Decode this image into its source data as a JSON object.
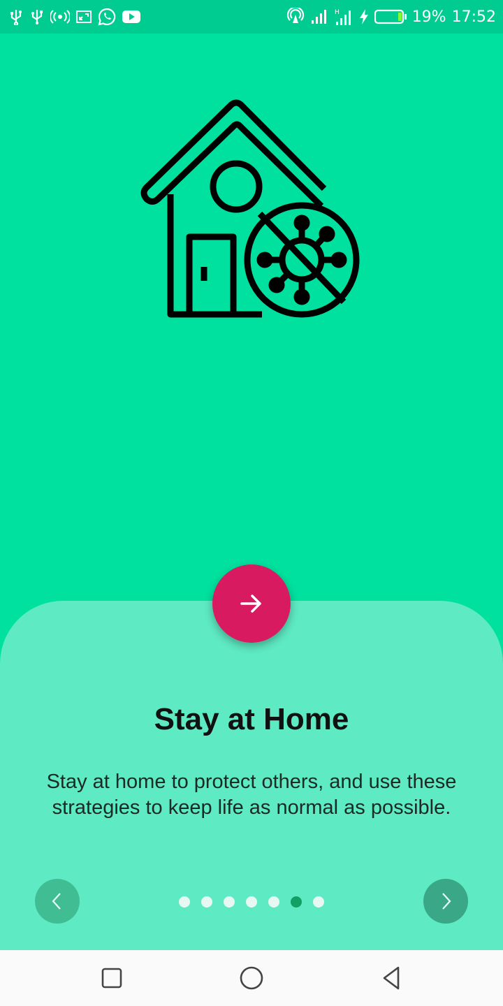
{
  "status_bar": {
    "left_icons": [
      "usb-icon",
      "usb-debug-icon",
      "hotspot-icon",
      "screen-cast-icon",
      "whatsapp-icon",
      "youtube-icon"
    ],
    "right_icons": [
      "wifi-icon",
      "signal-icon",
      "signal-h-icon",
      "charging-icon",
      "battery-icon"
    ],
    "battery": "19%",
    "time": "17:52"
  },
  "hero": {
    "icon": "stay-home-virus-icon"
  },
  "onboarding": {
    "title": "Stay at Home",
    "description": "Stay at home to protect others, and use these strategies to keep life as normal as possible.",
    "page_count": 7,
    "current_page": 6
  },
  "buttons": {
    "fab_icon": "arrow-right-icon",
    "prev_icon": "chevron-left-icon",
    "next_icon": "chevron-right-icon"
  },
  "colors": {
    "background": "#00E09E",
    "sheet": "#5EEAC2",
    "fab": "#D81B60",
    "dot_active": "#12A065",
    "dot_inactive": "#E6F8F1"
  },
  "nav_bar": {
    "buttons": [
      "recents-icon",
      "home-icon",
      "back-icon"
    ]
  }
}
